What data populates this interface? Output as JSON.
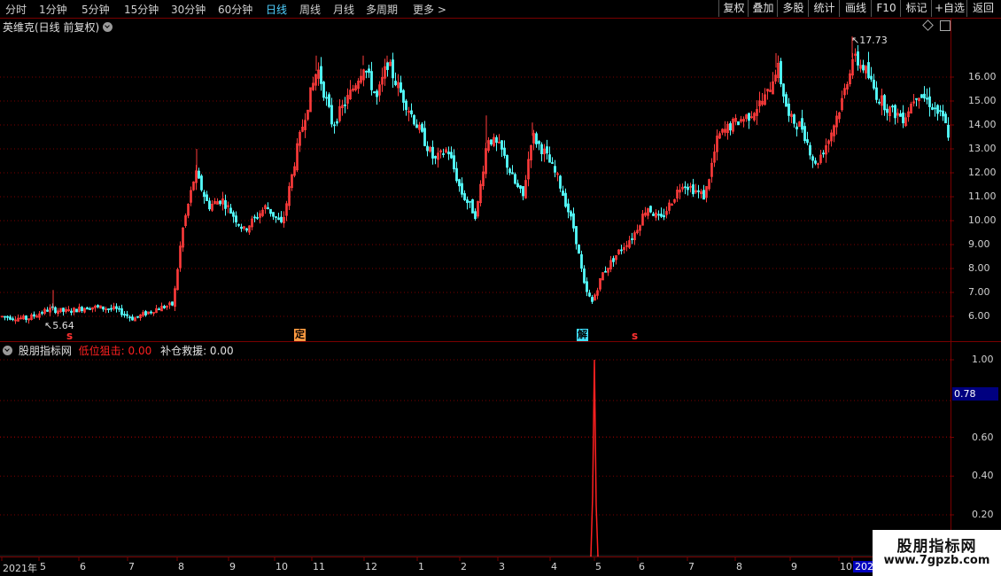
{
  "toolbar": {
    "periods": [
      "分时",
      "1分钟",
      "5分钟",
      "15分钟",
      "30分钟",
      "60分钟",
      "日线",
      "周线",
      "月线",
      "多周期",
      "更多 >"
    ],
    "active": "日线",
    "right_buttons": [
      "复权",
      "叠加",
      "多股",
      "统计",
      "画线",
      "F10",
      "标记",
      "+自选",
      "返回"
    ]
  },
  "main_panel": {
    "title": "英维克(日线 前复权)",
    "high_label": "17.73",
    "low_label": "5.64",
    "diamond_icon": "diamond-icon",
    "window_icon": "window-icon",
    "y_ticks": [
      "16.00",
      "15.00",
      "14.00",
      "13.00",
      "12.00",
      "11.00",
      "10.00",
      "9.00",
      "8.00",
      "7.00",
      "6.00"
    ],
    "markers": [
      "定",
      "解",
      "s",
      "s"
    ]
  },
  "indicator_panel": {
    "title": "股朋指标网",
    "line1_label": "低位狙击: 0.00",
    "line2_label": "补仓救援: 0.00",
    "y_ticks": [
      "1.00",
      "0.60",
      "0.40",
      "0.20"
    ],
    "current_value": "0.78",
    "colors": {
      "line1": "#ff2020",
      "line2": "#e0e0e0"
    }
  },
  "x_axis": {
    "labels": [
      "2021年",
      "5",
      "6",
      "7",
      "8",
      "9",
      "10",
      "11",
      "12",
      "1",
      "2",
      "3",
      "4",
      "5",
      "6",
      "7",
      "8",
      "9",
      "10",
      "202"
    ]
  },
  "watermark": {
    "title": "股朋指标网",
    "url": "www.7gpzb.com"
  },
  "colors": {
    "up": "#ff3b3b",
    "down": "#54ffff",
    "grid": "#7a0000",
    "bg": "#000000"
  }
}
